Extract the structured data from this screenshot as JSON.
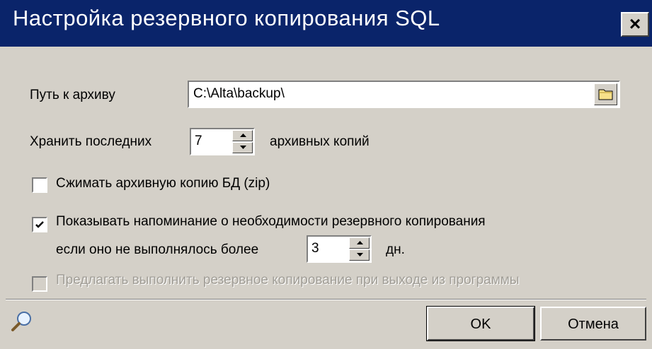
{
  "window": {
    "title": "Настройка резервного копирования SQL"
  },
  "path": {
    "label": "Путь к архиву",
    "value": "C:\\Alta\\backup\\"
  },
  "keep": {
    "label_before": "Хранить последних",
    "value": "7",
    "label_after": "архивных копий"
  },
  "compress": {
    "label": "Сжимать архивную копию БД (zip)",
    "checked": false
  },
  "reminder": {
    "label": "Показывать напоминание о необходимости резервного копирования",
    "line2_before": "если оно не выполнялось более",
    "value": "3",
    "line2_after": "дн.",
    "checked": true
  },
  "offer_on_exit": {
    "label": "Предлагать выполнить резервное копирование при выходе из программы",
    "checked": false,
    "enabled": false
  },
  "buttons": {
    "ok": "OK",
    "cancel": "Отмена"
  },
  "icons": {
    "close": "close-icon",
    "folder": "folder-icon",
    "search": "search-icon"
  }
}
